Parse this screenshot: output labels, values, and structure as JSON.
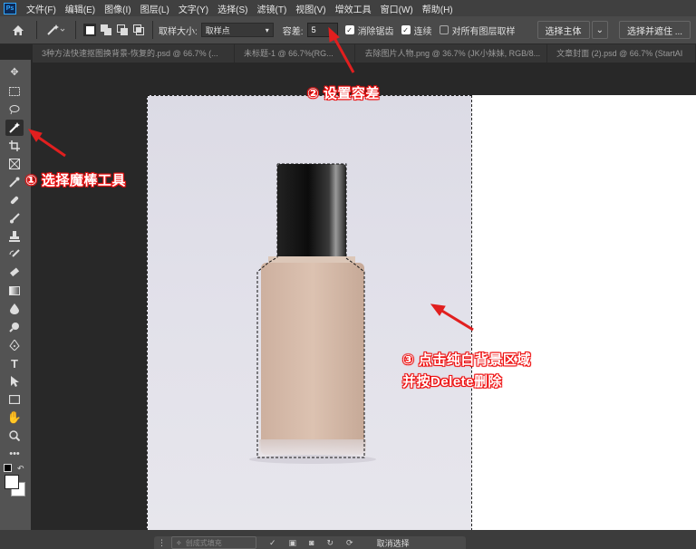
{
  "menubar": {
    "logo": "Ps",
    "items": [
      "文件(F)",
      "编辑(E)",
      "图像(I)",
      "图层(L)",
      "文字(Y)",
      "选择(S)",
      "滤镜(T)",
      "视图(V)",
      "增效工具",
      "窗口(W)",
      "帮助(H)"
    ]
  },
  "options": {
    "sample_size_label": "取样大小:",
    "sample_size_value": "取样点",
    "tolerance_label": "容差:",
    "tolerance_value": "5",
    "antialias_label": "消除锯齿",
    "contiguous_label": "连续",
    "sample_all_label": "对所有图层取样",
    "select_subject_label": "选择主体",
    "select_mask_label": "选择并遮住 ..."
  },
  "tabs": [
    "3种方法快速抠图换背景-恢复的.psd @ 66.7% (...",
    "未标题-1 @ 66.7%(RG...",
    "去除图片人物.png @ 36.7% (JK小妹妹, RGB/8...",
    "文章封面 (2).psd @ 66.7% (StartAI"
  ],
  "annotations": {
    "step1": "① 选择魔棒工具",
    "step2": "② 设置容差",
    "step3_line1": "③ 点击纯白背景区域",
    "step3_line2": "并按Delete删除"
  },
  "context_bar": {
    "text": "创成式填充",
    "deselect": "取消选择"
  },
  "colors": {
    "annotation_red": "#e11f1f",
    "foundation": "#d9bfae"
  }
}
